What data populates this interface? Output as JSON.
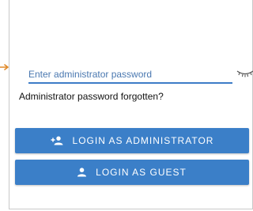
{
  "password": {
    "placeholder": "Enter administrator password",
    "value": ""
  },
  "links": {
    "forgot": "Administrator password forgotten?"
  },
  "buttons": {
    "login_admin": "LOGIN AS ADMINISTRATOR",
    "login_guest": "LOGIN AS GUEST"
  },
  "icons": {
    "side_marker": "arrow-right-icon",
    "password_toggle": "eye-closed-icon",
    "admin": "admin-person-icon",
    "guest": "person-icon"
  },
  "colors": {
    "accent": "#3b7fc8",
    "underline": "#3d7cc7",
    "placeholder": "#4a78b0",
    "marker": "#e08a2a"
  }
}
